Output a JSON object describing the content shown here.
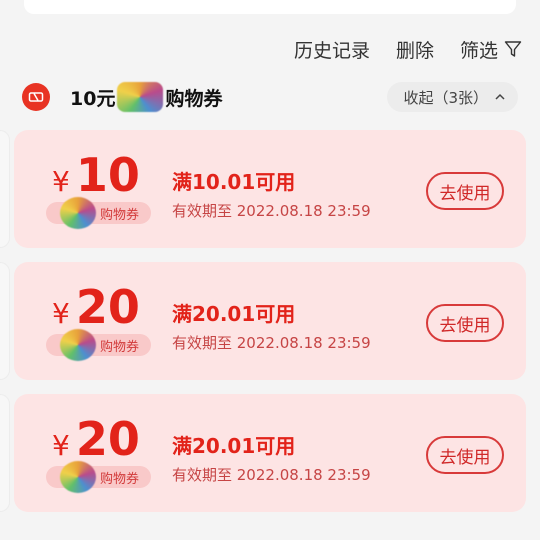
{
  "toolbar": {
    "history_label": "历史记录",
    "delete_label": "删除",
    "filter_label": "筛选"
  },
  "group": {
    "title_prefix": "10元",
    "title_suffix": "购物券",
    "collapse_label": "收起（3张）"
  },
  "coupons": [
    {
      "currency": "¥",
      "amount": "10",
      "condition": "满10.01可用",
      "validity": "有效期至 2022.08.18 23:59",
      "tag": "购物券",
      "action": "去使用"
    },
    {
      "currency": "¥",
      "amount": "20",
      "condition": "满20.01可用",
      "validity": "有效期至 2022.08.18 23:59",
      "tag": "购物券",
      "action": "去使用"
    },
    {
      "currency": "¥",
      "amount": "20",
      "condition": "满20.01可用",
      "validity": "有效期至 2022.08.18 23:59",
      "tag": "购物券",
      "action": "去使用"
    }
  ],
  "colors": {
    "accent": "#e2231a",
    "coupon_bg": "#fde4e4"
  },
  "icons": {
    "filter": "filter-funnel-icon",
    "ticket": "ticket-icon",
    "chevron": "chevron-up-icon"
  }
}
